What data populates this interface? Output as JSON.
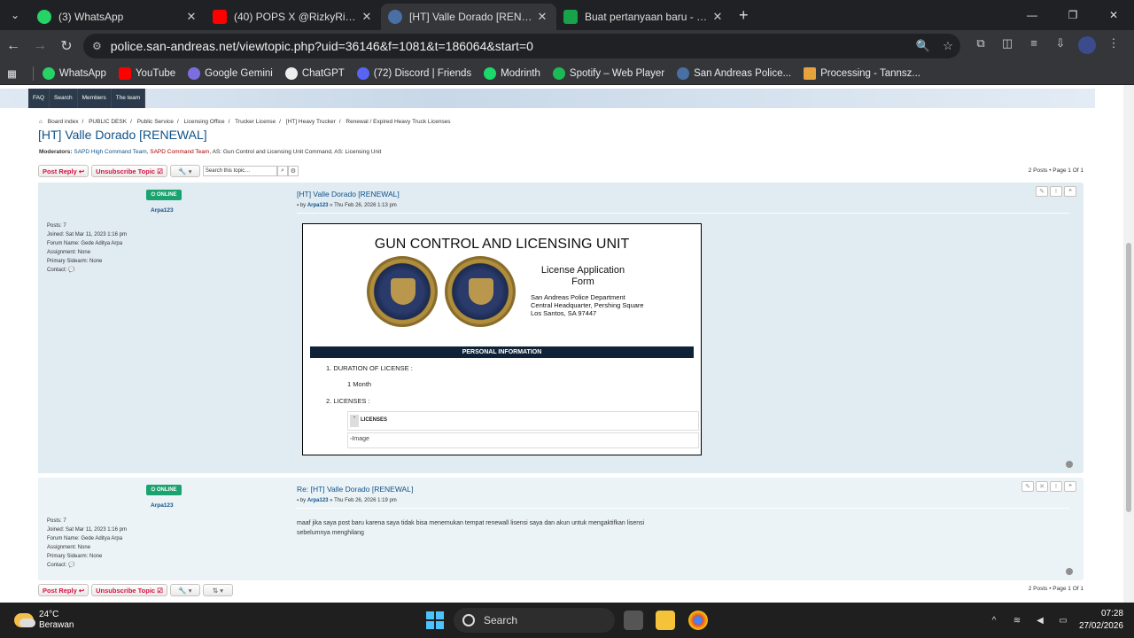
{
  "browser": {
    "tabs": [
      {
        "title": "(3) WhatsApp",
        "color": "#25d366",
        "active": false
      },
      {
        "title": "(40) POPS X @RizkyRiplay - MS",
        "color": "#ff0000",
        "active": false
      },
      {
        "title": "[HT] Valle Dorado [RENEWAL] -",
        "color": "#4a6fa5",
        "active": true
      },
      {
        "title": "Buat pertanyaan baru - Jogjaga",
        "color": "#16a34a",
        "active": false
      }
    ],
    "url": "police.san-andreas.net/viewtopic.php?uid=36146&f=1081&t=186064&start=0",
    "bookmarks": [
      "WhatsApp",
      "YouTube",
      "Google Gemini",
      "ChatGPT",
      "(72) Discord | Friends",
      "Modrinth",
      "Spotify – Web Player",
      "San Andreas Police...",
      "Processing - Tannsz..."
    ]
  },
  "forum": {
    "nav": [
      "FAQ",
      "Search",
      "Members",
      "The team"
    ],
    "breadcrumb": [
      "Board index",
      "PUBLIC DESK",
      "Public Service",
      "Licensing Office",
      "Trucker License",
      "[HT] Heavy Trucker",
      "Renewal / Expired Heavy Truck Licenses"
    ],
    "title": "[HT] Valle Dorado [RENEWAL]",
    "moderators_label": "Moderators:",
    "moderators_blue": "SAPD High Command Team",
    "moderators_red": "SAPD Command Team",
    "moderators_rest": ", AS: Gun Control and Licensing Unit Command, AS: Licensing Unit",
    "post_reply": "Post Reply",
    "unsubscribe": "Unsubscribe Topic",
    "search_placeholder": "Search this topic…",
    "pagination": "2 Posts • Page 1 Of 1",
    "online": "ONLINE",
    "username": "Arpa123",
    "profile": {
      "posts": "Posts: 7",
      "joined": "Joined: Sat Mar 11, 2023 1:16 pm",
      "forum_name": "Forum Name: Gede Aditya Arpa",
      "assignment": "Assignment: None",
      "sidearm": "Primary Sidearm: None",
      "contact": "Contact:"
    },
    "post1": {
      "title": "[HT] Valle Dorado [RENEWAL]",
      "meta": "» Thu Feb 26, 2026 1:13 pm"
    },
    "post2": {
      "title": "Re: [HT] Valle Dorado [RENEWAL]",
      "meta": "» Thu Feb 26, 2026 1:19 pm",
      "body1": "maaf jika saya post baru karena saya tidak bisa menemukan tempat renewall lisensi saya dan akun untuk mengaktifkan lisensi",
      "body2": "sebelumnya menghilang"
    },
    "by": "by"
  },
  "form": {
    "heading": "GUN CONTROL AND LICENSING UNIT",
    "label1": "License Application",
    "label2": "Form",
    "addr1": "San Andreas Police Department",
    "addr2": "Central Headquarter, Pershing Square",
    "addr3": "Los Santos, SA 97447",
    "section": "PERSONAL INFORMATION",
    "item1": "1. DURATION OF LICENSE :",
    "val1": "1 Month",
    "item2": "2. LICENSES :",
    "licenses": "LICENSES",
    "image_alt": "Image"
  },
  "taskbar": {
    "temp": "24°C",
    "weather": "Berawan",
    "search": "Search",
    "time": "07:28",
    "date": "27/02/2026"
  }
}
